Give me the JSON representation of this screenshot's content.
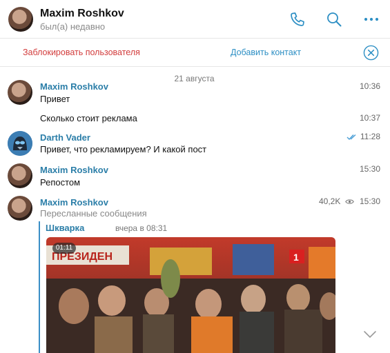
{
  "header": {
    "name": "Maxim Roshkov",
    "status": "был(а) недавно"
  },
  "actionbar": {
    "block_label": "Заблокировать пользователя",
    "add_label": "Добавить контакт"
  },
  "date_divider": "21 августа",
  "messages": [
    {
      "sender": "Maxim Roshkov",
      "text": "Привет",
      "time": "10:36"
    },
    {
      "text": "Сколько стоит реклама",
      "time": "10:37"
    },
    {
      "sender": "Darth Vader",
      "text": "Привет, что рекламируем? И какой пост",
      "time": "11:28",
      "read": true
    },
    {
      "sender": "Maxim Roshkov",
      "text": "Репостом",
      "time": "15:30"
    },
    {
      "sender": "Maxim Roshkov",
      "label": "Пересланные сообщения",
      "views": "40,2K",
      "time": "15:30",
      "forward": {
        "from": "Шкварка",
        "time": "вчера в 08:31",
        "video_duration": "01:11",
        "video_text": [
          "ПРЕЗИДЕН",
          "1"
        ]
      }
    }
  ],
  "colors": {
    "link": "#2b7ea8",
    "danger": "#d23b3b",
    "accent": "#2d8fc4"
  },
  "icons": {
    "call": "phone-icon",
    "search": "search-icon",
    "more": "more-icon",
    "close": "close-icon"
  }
}
